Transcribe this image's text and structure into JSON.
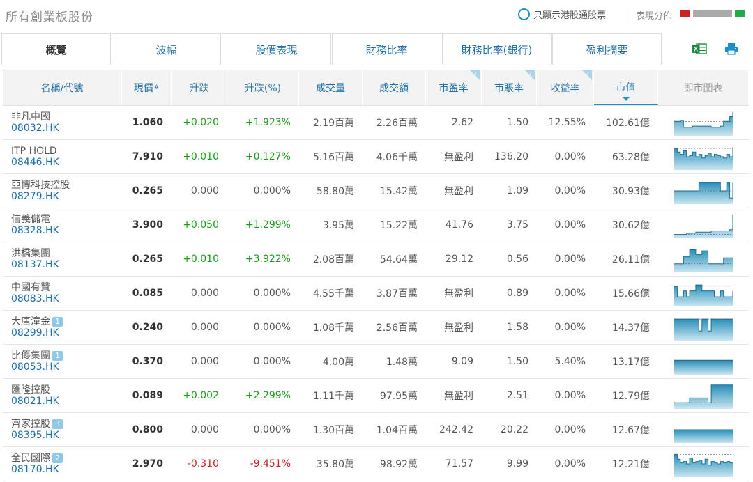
{
  "header": {
    "title": "所有創業板股份",
    "hk_connect_label": "只顯示港股通股票",
    "distribution_label": "表現分佈"
  },
  "tabs": [
    {
      "label": "概覽",
      "active": true
    },
    {
      "label": "波幅"
    },
    {
      "label": "股價表現"
    },
    {
      "label": "財務比率"
    },
    {
      "label": "財務比率(銀行)"
    },
    {
      "label": "盈利摘要"
    }
  ],
  "colors": {
    "accent": "#1a8fc9",
    "link": "#1f6fa8",
    "up": "#1a9c1a",
    "down": "#cc2222",
    "chart_fill": "#2a8fb8"
  },
  "icons": {
    "export": "excel-icon",
    "print": "print-icon"
  },
  "columns": [
    {
      "label": "名稱/代號"
    },
    {
      "label": "現價",
      "sup": "#"
    },
    {
      "label": "升跌"
    },
    {
      "label": "升跌(%)"
    },
    {
      "label": "成交量"
    },
    {
      "label": "成交額"
    },
    {
      "label": "市盈率",
      "hint": "?"
    },
    {
      "label": "市賬率",
      "hint": "?"
    },
    {
      "label": "收益率",
      "hint": "?"
    },
    {
      "label": "市值",
      "sorted": true
    },
    {
      "label": "即市圖表"
    }
  ],
  "rows": [
    {
      "name": "非凡中國",
      "code": "08032.HK",
      "badge": "",
      "price": "1.060",
      "change": "+0.020",
      "pct": "+1.923%",
      "dir": "up",
      "volume": "2.19百萬",
      "turnover": "2.26百萬",
      "pe": "2.62",
      "pb": "1.50",
      "yield": "12.55%",
      "mcap": "102.61億",
      "spark": [
        0.55,
        0.55,
        0.6,
        0.3,
        0.3,
        0.3,
        0.35,
        0.35,
        0.35,
        0.35,
        0.35,
        0.35,
        0.3,
        0.3,
        0.3,
        0.35,
        0.55,
        0.55,
        0.75,
        0.95
      ]
    },
    {
      "name": "ITP HOLD",
      "code": "08446.HK",
      "badge": "",
      "price": "7.910",
      "change": "+0.010",
      "pct": "+0.127%",
      "dir": "up",
      "volume": "5.16百萬",
      "turnover": "4.06千萬",
      "pe": "無盈利",
      "pb": "136.20",
      "yield": "0.00%",
      "mcap": "63.28億",
      "spark": [
        0.85,
        0.7,
        0.6,
        0.75,
        0.5,
        0.55,
        0.7,
        0.5,
        0.6,
        0.45,
        0.55,
        0.65,
        0.5,
        0.6,
        0.55,
        0.5,
        0.45,
        0.6,
        0.5,
        0.9
      ]
    },
    {
      "name": "亞博科技控股",
      "code": "08279.HK",
      "badge": "",
      "price": "0.265",
      "change": "0.000",
      "pct": "0.000%",
      "dir": "flat",
      "volume": "58.80萬",
      "turnover": "15.42萬",
      "pe": "無盈利",
      "pb": "1.09",
      "yield": "0.00%",
      "mcap": "30.93億",
      "spark": [
        0.5,
        0.5,
        0.5,
        0.5,
        0.5,
        0.5,
        0.5,
        0.5,
        0.85,
        0.85,
        0.85,
        0.85,
        0.85,
        0.85,
        0.85,
        0.5,
        0.5,
        0.85,
        0.2,
        0.85
      ]
    },
    {
      "name": "信義儲電",
      "code": "08328.HK",
      "badge": "",
      "price": "3.900",
      "change": "+0.050",
      "pct": "+1.299%",
      "dir": "up",
      "volume": "3.95萬",
      "turnover": "15.22萬",
      "pe": "41.76",
      "pb": "3.75",
      "yield": "0.00%",
      "mcap": "30.62億",
      "spark": [
        0.1,
        0.1,
        0.1,
        0.1,
        0.15,
        0.15,
        0.15,
        0.2,
        0.2,
        0.2,
        0.2,
        0.2,
        0.25,
        0.25,
        0.25,
        0.25,
        0.25,
        0.25,
        0.3,
        0.95
      ]
    },
    {
      "name": "洪橋集團",
      "code": "08137.HK",
      "badge": "",
      "price": "0.265",
      "change": "+0.010",
      "pct": "+3.922%",
      "dir": "up",
      "volume": "2.08百萬",
      "turnover": "54.64萬",
      "pe": "29.12",
      "pb": "0.56",
      "yield": "0.00%",
      "mcap": "26.11億",
      "spark": [
        0.3,
        0.3,
        0.3,
        0.6,
        0.6,
        0.9,
        0.9,
        0.7,
        0.7,
        0.85,
        0.85,
        0.3,
        0.3,
        0.3,
        0.3,
        0.3,
        0.55,
        0.55,
        0.55,
        0.55
      ]
    },
    {
      "name": "中國有贊",
      "code": "08083.HK",
      "badge": "",
      "price": "0.085",
      "change": "0.000",
      "pct": "0.000%",
      "dir": "flat",
      "volume": "4.55千萬",
      "turnover": "3.87百萬",
      "pe": "無盈利",
      "pb": "0.89",
      "yield": "0.00%",
      "mcap": "15.66億",
      "spark": [
        0.8,
        0.35,
        0.35,
        0.6,
        0.35,
        0.6,
        0.6,
        0.85,
        0.85,
        0.6,
        0.6,
        0.6,
        0.6,
        0.35,
        0.35,
        0.6,
        0.35,
        0.35,
        0.35,
        0.6
      ]
    },
    {
      "name": "大唐潼金",
      "code": "08299.HK",
      "badge": "1",
      "price": "0.240",
      "change": "0.000",
      "pct": "0.000%",
      "dir": "flat",
      "volume": "1.08千萬",
      "turnover": "2.56百萬",
      "pe": "無盈利",
      "pb": "1.58",
      "yield": "0.00%",
      "mcap": "14.37億",
      "spark": [
        0.85,
        0.85,
        0.85,
        0.85,
        0.85,
        0.85,
        0.85,
        0.85,
        0.35,
        0.85,
        0.85,
        0.35,
        0.85,
        0.85,
        0.85,
        0.85,
        0.85,
        0.85,
        0.85,
        0.85
      ]
    },
    {
      "name": "比優集團",
      "code": "08053.HK",
      "badge": "1",
      "price": "0.370",
      "change": "0.000",
      "pct": "0.000%",
      "dir": "flat",
      "volume": "4.00萬",
      "turnover": "1.48萬",
      "pe": "9.09",
      "pb": "1.50",
      "yield": "5.40%",
      "mcap": "13.17億",
      "spark": [
        0.55,
        0.55,
        0.55,
        0.55,
        0.55,
        0.55,
        0.55,
        0.55,
        0.55,
        0.55,
        0.55,
        0.55,
        0.55,
        0.55,
        0.55,
        0.55,
        0.55,
        0.55,
        0.55,
        0.55
      ]
    },
    {
      "name": "匯隆控股",
      "code": "08021.HK",
      "badge": "",
      "price": "0.089",
      "change": "+0.002",
      "pct": "+2.299%",
      "dir": "up",
      "volume": "1.11千萬",
      "turnover": "97.95萬",
      "pe": "無盈利",
      "pb": "2.51",
      "yield": "0.00%",
      "mcap": "12.79億",
      "spark": [
        0.2,
        0.2,
        0.2,
        0.2,
        0.2,
        0.4,
        0.4,
        0.4,
        0.4,
        0.4,
        0.4,
        0.2,
        0.95,
        0.95,
        0.95,
        0.95,
        0.95,
        0.95,
        0.95,
        0.95
      ]
    },
    {
      "name": "齊家控股",
      "code": "08395.HK",
      "badge": "3",
      "price": "0.800",
      "change": "0.000",
      "pct": "0.000%",
      "dir": "flat",
      "volume": "1.30百萬",
      "turnover": "1.04百萬",
      "pe": "242.42",
      "pb": "20.22",
      "yield": "0.00%",
      "mcap": "12.67億",
      "spark": [
        0.5,
        0.5,
        0.5,
        0.5,
        0.5,
        0.5,
        0.5,
        0.5,
        0.5,
        0.5,
        0.5,
        0.5,
        0.5,
        0.5,
        0.5,
        0.5,
        0.5,
        0.5,
        0.5,
        0.5
      ]
    },
    {
      "name": "全民國際",
      "code": "08170.HK",
      "badge": "2",
      "price": "2.970",
      "change": "-0.310",
      "pct": "-9.451%",
      "dir": "down",
      "volume": "35.80萬",
      "turnover": "98.92萬",
      "pe": "71.57",
      "pb": "9.99",
      "yield": "0.00%",
      "mcap": "12.21億",
      "spark": [
        0.9,
        0.7,
        0.55,
        0.6,
        0.5,
        0.75,
        0.55,
        0.6,
        0.65,
        0.5,
        0.7,
        0.45,
        0.6,
        0.55,
        0.5,
        0.6,
        0.55,
        0.6,
        0.55,
        0.55
      ]
    }
  ]
}
